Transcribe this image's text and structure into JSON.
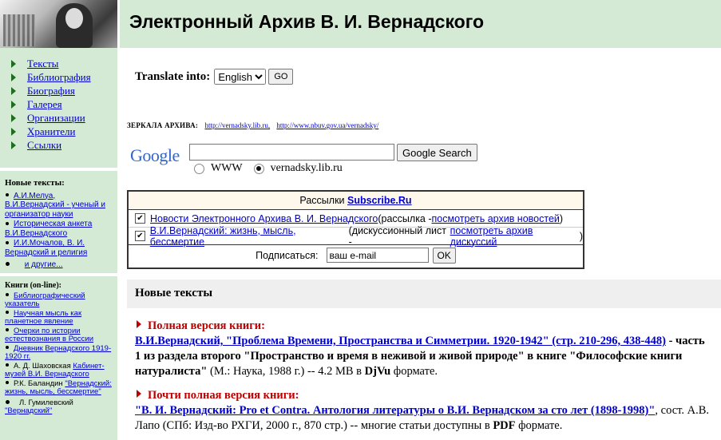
{
  "header": {
    "title": "Электронный Архив В. И. Вернадского"
  },
  "nav": [
    {
      "label": "Тексты"
    },
    {
      "label": "Библиография"
    },
    {
      "label": "Биография"
    },
    {
      "label": "Галерея"
    },
    {
      "label": "Организации"
    },
    {
      "label": "Хранители"
    },
    {
      "label": "Ссылки"
    }
  ],
  "new_texts_box": {
    "heading": "Новые тексты:",
    "items": [
      "А.И.Мелуа, В.И.Вернадский - ученый и организатор науки",
      "Историческая анкета В.И.Вернадского",
      "И.И.Мочалов, В. И. Вернадский и религия"
    ],
    "more": "и другие..."
  },
  "books_box": {
    "heading": "Книги (on-line):",
    "items": [
      {
        "prefix": "",
        "link": "Библиографический указатель"
      },
      {
        "prefix": "",
        "link": "Научная мысль как планетное явление"
      },
      {
        "prefix": "",
        "link": "Очерки по истории естествознания в России"
      },
      {
        "prefix": "",
        "link": "Дневник Вернадского 1919-1920 гг."
      },
      {
        "prefix": "А. Д. Шаховская ",
        "link": "Кабинет-музей В.И. Вернадского"
      },
      {
        "prefix": "Р.К. Баландин ",
        "link": "\"Вернадский: жизнь, мысль, бессмертие\""
      },
      {
        "prefix": "Л. Гумилевский ",
        "link": "\"Вернадский\""
      }
    ]
  },
  "translate": {
    "label": "Translate into:",
    "selected": "English",
    "go": "GO"
  },
  "mirrors": {
    "label": "ЗЕРКАЛА АРХИВА:",
    "link1": "http://vernadsky.lib.ru,",
    "link2": "http://www.nbuv.gov.ua/vernadsky/"
  },
  "google": {
    "logo": "Google",
    "button": "Google Search",
    "opt1": "WWW",
    "opt2": "vernadsky.lib.ru"
  },
  "subscribe": {
    "head_text": "Рассылки ",
    "head_link": "Subscribe.Ru",
    "row1_link": "Новости Электронного Архива В. И. Вернадского",
    "row1_mid": " (рассылка - ",
    "row1_link2": "посмотреть архив новостей",
    "row1_end": ")",
    "row2_link": "В.И.Вернадский: жизнь, мысль, бессмертие",
    "row2_mid": " (дискуссионный лист - ",
    "row2_link2": "посмотреть архив дискуссий",
    "row2_end": ")",
    "subscribe_label": "Подписаться:",
    "email_value": "ваш e-mail",
    "ok": "OK"
  },
  "new_section": {
    "title": "Новые тексты"
  },
  "entries": [
    {
      "label": "Полная версия книги:",
      "title": "В.И.Вернадский, \"Проблема Времени, Пространства и Симметрии. 1920-1942\" (стр. 210-296, 438-448)",
      "desc1": " - часть 1 из раздела второго \"Пространство и время в неживой и живой природе\" в книге \"Философские книги натуралиста\"",
      "desc2": " (М.: Наука, 1988 г.) -- 4.2 MB в ",
      "fmt": "DjVu",
      "desc3": " формате."
    },
    {
      "label": "Почти полная версия книги:",
      "title": "\"В. И. Вернадский: Pro et Contra. Антология литературы о В.И. Вернадском за сто лет (1898-1998)\"",
      "desc1": ", сост. А.В. Лапо (СПб: Изд-во РХГИ, 2000 г., 870 стр.) -- многие статьи доступны в ",
      "fmt": "PDF",
      "desc3": " формате."
    }
  ]
}
